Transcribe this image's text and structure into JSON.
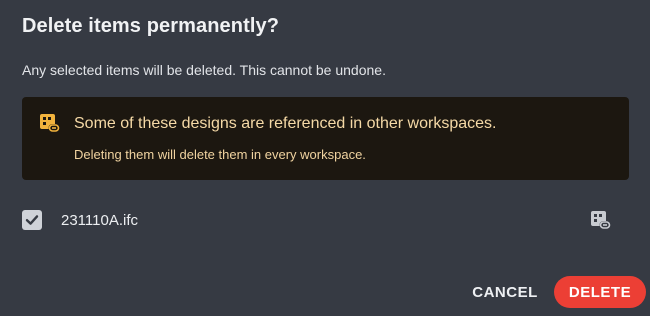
{
  "dialog": {
    "title": "Delete items permanently?",
    "subtitle": "Any selected items will be deleted. This cannot be undone."
  },
  "warning": {
    "icon": "shared-design-link-icon",
    "heading": "Some of these designs are referenced in other workspaces.",
    "detail": "Deleting them will delete them in every workspace."
  },
  "items": [
    {
      "name": "231110A.ifc",
      "checked": true,
      "icon": "shared-design-link-icon"
    }
  ],
  "actions": {
    "cancel_label": "CANCEL",
    "delete_label": "DELETE"
  },
  "colors": {
    "background": "#363a43",
    "warning_background": "#1c1710",
    "warning_text": "#f5d9a6",
    "warning_icon": "#f2b33d",
    "delete_button": "#ec3f35"
  }
}
